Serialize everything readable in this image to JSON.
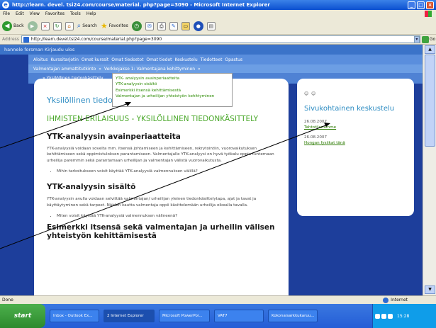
{
  "window": {
    "title": "http://learn. devel. tsi24.com/course/material. php?page=3090 - Microsoft Internet Explorer"
  },
  "menu": [
    "File",
    "Edit",
    "View",
    "Favorites",
    "Tools",
    "Help"
  ],
  "toolbar": {
    "back": "Back",
    "search": "Search",
    "favorites": "Favorites"
  },
  "address": {
    "label": "Address",
    "url": "http://learn.devel.tsi24.com/course/material.php?page=3090",
    "go": "Go"
  },
  "site": {
    "user_bar": "hannele forsman Kirjaudu ulos",
    "main_nav": [
      "Aloitus",
      "Kurssitarjotin",
      "Omat kurssit",
      "Omat tiedostot",
      "Omat tiedot",
      "Keskustelu",
      "Tiedotteet",
      "Opastus"
    ],
    "breadcrumb_1": [
      "Valmentajan ammattitutkinto",
      "»",
      "Verkkojakso 1: Valmentajana kehittyminen",
      "»"
    ],
    "breadcrumb_2": "» Yksilöllinen tiedonkäsittely",
    "dropdown_items": [
      "YTK- analyysin avainperiaatteita",
      "YTK-analyysin sisältö",
      "Esimerkki itsensä kehittämisestä",
      "Valmentajan ja urheilijan yhteistyön kehittyminen"
    ]
  },
  "content": {
    "page_title": "Yksilöllinen tiedo",
    "subtitle": "IHMISTEN ERILAISUUS - YKSILÖLLINEN TIEDONKÄSITTELY",
    "section1_heading": "YTK-analyysin avainperiaatteita",
    "section1_text": "YTK-analyysiä voidaan sovelta mm. itsensä johtamiseen ja kehittämiseen, rekrytointiin, vuorovaikutuksen kehittämiseen sekä oppimistuloksen parantamiseen. Valmentajalle YTK-analyysi on hyvä työkalu oppia tuntemaan urheilija paremmin sekä parantamaan urheilijan ja valmentajan välistä vuorovaikutusta.",
    "section1_bullet": "Mihin tarkoitukseen voisit käyttää YTK-analyysiä valmennuksen välillä?",
    "section2_heading": "YTK-analyysin sisältö",
    "section2_text": "YTK-analyysin avulla voidaan selvittää valmentajan/ urheilijan yleinen tiedonkäsittelytapa, ajat ja tavat ja käyttäytyminen sekä tarpeet. Näiden kautta valmentaja oppii käsittelemään urheilija oikealla tavalla.",
    "section2_bullet": "Miten voisit käyttää YTK-analyysiä valmennuksen välineenä?",
    "section3_heading": "Esimerkki itsensä sekä valmentajan ja urheilin välisen yhteistyön kehittämisestä"
  },
  "sidebar": {
    "title": "Sivukohtainen keskustelu",
    "posts": [
      {
        "date": "26.08.2007",
        "link": "Tahtotilanamme"
      },
      {
        "date": "26.08.2007",
        "link": "Hongan fysiikat tänä"
      }
    ]
  },
  "statusbar": {
    "left": "Done",
    "zone": "Internet"
  },
  "taskbar": {
    "start": "start",
    "items": [
      "Inbox - Outlook Ex...",
      "2 Internet Explorer",
      "Microsoft PowerPoi...",
      "VAT7",
      "Kokonaisarkkukaruu..."
    ],
    "clock": "15:28"
  },
  "colors": {
    "page_bg": "#1d3e9b",
    "nav_blue": "#3b73c9",
    "title_blue": "#2d8cc2",
    "green_text": "#4aa82a",
    "link_green": "#2b8a00"
  }
}
